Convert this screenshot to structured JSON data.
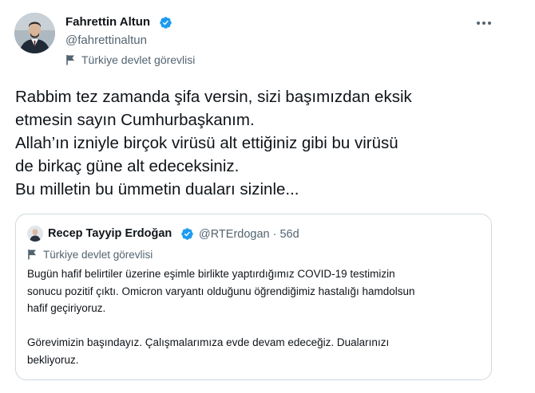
{
  "author": {
    "name": "Fahrettin Altun",
    "handle": "@fahrettinaltun",
    "label": "Türkiye devlet görevlisi"
  },
  "icons": {
    "verified": "verified-badge-icon",
    "flag": "flag-icon",
    "more": "more-icon"
  },
  "colors": {
    "verified": "#1d9bf0",
    "secondary_text": "#536471",
    "border": "#cfd9de"
  },
  "tweet": {
    "lines": [
      "Rabbim tez zamanda şifa versin, sizi başımızdan eksik",
      "etmesin sayın Cumhurbaşkanım.",
      "Allah’ın izniyle birçok virüsü alt ettiğiniz gibi bu virüsü",
      "de birkaç güne alt edeceksiniz.",
      "Bu milletin bu ümmetin duaları sizinle..."
    ]
  },
  "quoted": {
    "name": "Recep Tayyip Erdoğan",
    "handle_time": "@RTErdogan · 56d",
    "label": "Türkiye devlet görevlisi",
    "lines": [
      "Bugün hafif belirtiler üzerine eşimle birlikte yaptırdığımız COVID-19 testimizin",
      "sonucu pozitif çıktı. Omicron varyantı olduğunu öğrendiğimiz hastalığı hamdolsun",
      "hafif geçiriyoruz.",
      "",
      "Görevimizin başındayız. Çalışmalarımıza evde devam edeceğiz. Dualarınızı",
      "bekliyoruz."
    ]
  }
}
